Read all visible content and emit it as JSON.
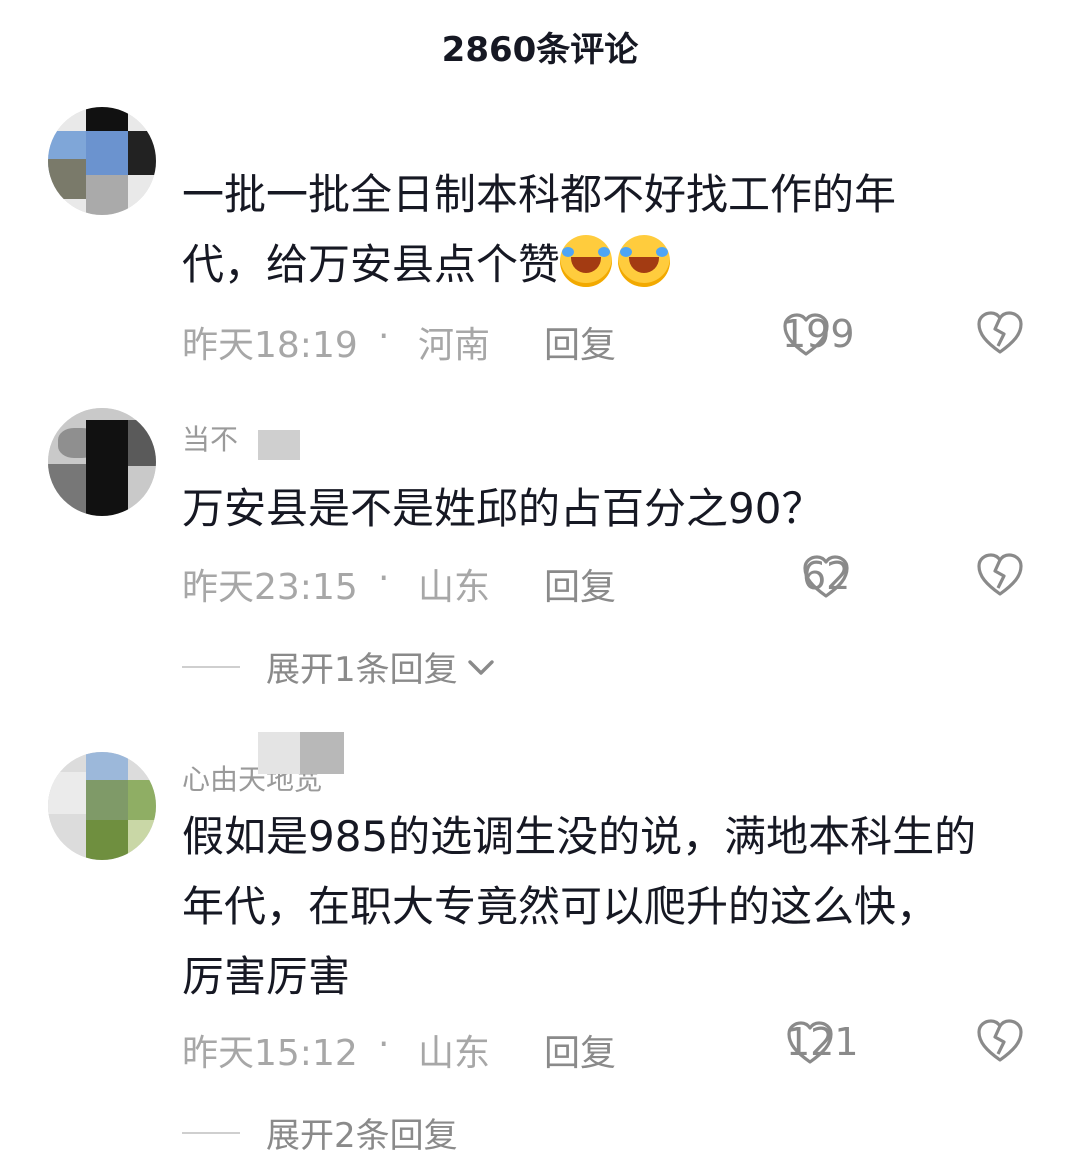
{
  "header": {
    "title": "2860条评论"
  },
  "comments": [
    {
      "username": "",
      "text_line1": "一批一批全日制本科都不好找工作的年",
      "text_line2": "代，给万安县点个赞",
      "emojis": [
        "laughing-tears-emoji",
        "laughing-tears-emoji"
      ],
      "time": "昨天18:19",
      "dot": "·",
      "location": "河南",
      "reply_label": "回复",
      "likes": "199"
    },
    {
      "username": "当不",
      "text_line1": "万安县是不是姓邱的占百分之90？",
      "time": "昨天23:15",
      "dot": "·",
      "location": "山东",
      "reply_label": "回复",
      "likes": "62",
      "expand_label": "展开1条回复"
    },
    {
      "username": "心由天地宽",
      "text_line1": "假如是985的选调生没的说，满地本科生的",
      "text_line2": "年代，在职大专竟然可以爬升的这么快，",
      "text_line3": "厉害厉害",
      "time": "昨天15:12",
      "dot": "·",
      "location": "山东",
      "reply_label": "回复",
      "likes": "121",
      "expand_label": "展开2条回复"
    }
  ],
  "colors": {
    "text": "#161823",
    "meta": "#a7a7a7",
    "icon": "#8a8a8a",
    "emoji": "#ffcc3d"
  }
}
